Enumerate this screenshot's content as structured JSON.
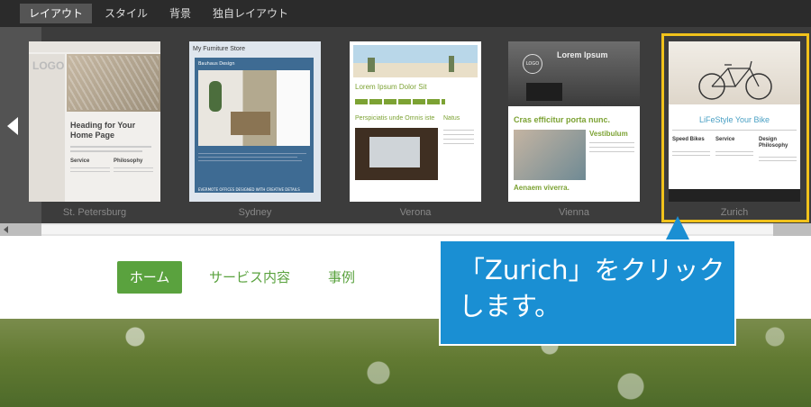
{
  "tabs": [
    {
      "label": "レイアウト",
      "active": true
    },
    {
      "label": "スタイル",
      "active": false
    },
    {
      "label": "背景",
      "active": false
    },
    {
      "label": "独自レイアウト",
      "active": false
    }
  ],
  "layouts": [
    {
      "name": "St. Petersburg",
      "heading": "Heading for Your Home Page",
      "logo": "LOGO",
      "col1": "Service",
      "col2": "Philosophy"
    },
    {
      "name": "Sydney",
      "site_title": "My Furniture Store",
      "hero_title": "Bauhaus Design",
      "banner": "EVERMOTE OFFICES DESIGNED WITH CREATIVE DETAILS"
    },
    {
      "name": "Verona",
      "title": "Lorem Ipsum Dolor Sit",
      "sub1": "Perspiciatis unde Omnis iste",
      "sub2": "Natus"
    },
    {
      "name": "Vienna",
      "title": "Lorem Ipsum",
      "logo": "LOGO",
      "heading": "Cras efficitur porta nunc.",
      "side_title": "Vestibulum",
      "caption": "Aenaem viverra."
    },
    {
      "name": "Zurich",
      "title": "LiFeStyle Your Bike",
      "col1": "Speed Bikes",
      "col2": "Service",
      "col3": "Design Philosophy"
    }
  ],
  "site_nav": {
    "home": "ホーム",
    "services": "サービス内容",
    "cases": "事例"
  },
  "callout": {
    "line1": "「Zurich」をクリック",
    "line2": "します。"
  },
  "colors": {
    "accent_green": "#5aa23e",
    "callout_blue": "#1a8fd3",
    "highlight_yellow": "#f1c21b"
  }
}
